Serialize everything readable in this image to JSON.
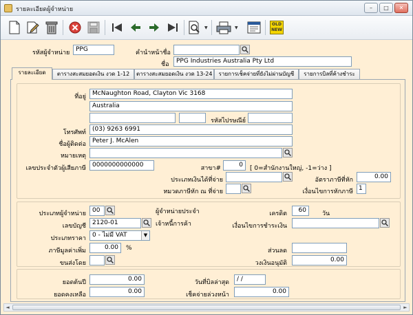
{
  "window": {
    "title": "รายละเอียดผู้จำหน่าย"
  },
  "titlebar": {
    "minimize": "–",
    "maximize": "□",
    "close": "✕"
  },
  "toolbar": {
    "new_icon_text": "OLD NEW"
  },
  "header": {
    "vendor_code_label": "รหัสผู้จำหน่าย",
    "vendor_code": "PPG",
    "prefix_label": "คำนำหน้าชื่อ",
    "prefix": "",
    "name_label": "ชื่อ",
    "name": "PPG Industries Australia Pty Ltd"
  },
  "tabs": [
    {
      "label": "รายละเอียด"
    },
    {
      "label": "ตารางสะสมยอดเงิน งวด  1-12"
    },
    {
      "label": "ตารางสะสมยอดเงิน งวด 13-24"
    },
    {
      "label": "รายการเช็คจ่ายที่ยังไม่ผ่านบัญชี"
    },
    {
      "label": "รายการบิลที่ค้างชำระ"
    }
  ],
  "details": {
    "address_label": "ที่อยู่",
    "address1": "McNaughton Road, Clayton Vic 3168",
    "address2": "Australia",
    "address3a": "",
    "address3b": "",
    "postcode_label": "รหัสไปรษณีย์",
    "postcode": "",
    "phone_label": "โทรศัพท์",
    "phone": "(03) 9263 6991",
    "contact_label": "ชื่อผู้ติดต่อ",
    "contact": "Peter J. McAlen",
    "note_label": "หมายเหตุ",
    "note": "",
    "taxid_label": "เลขประจำตัวผู้เสียภาษี",
    "taxid": "0000000000000",
    "branch_label": "สาขา#",
    "branch": "0",
    "branch_hint": "[ 0=สำนักงานใหญ่, -1=ว่าง ]",
    "payment_type_label": "ประเภทเงินได้ที่จ่าย",
    "payment_type": "",
    "wht_rate_label": "อัตราภาษีที่หัก",
    "wht_rate": "0.00",
    "wht_category_label": "หมวดภาษีหัก ณ ที่จ่าย",
    "wht_category": "",
    "wht_condition_label": "เงื่อนไขการหักภาษี",
    "wht_condition": "1"
  },
  "trade": {
    "vendor_type_label": "ประเภทผู้จำหน่าย",
    "vendor_type": "00",
    "regular_vendor_label": "ผู้จำหน่ายประจำ",
    "credit_label": "เครดิต",
    "credit_days": "60",
    "days_label": "วัน",
    "account_label": "เลขบัญชี",
    "account": "2120-01",
    "trade_creditor_label": "เจ้าหนี้การค้า",
    "payment_terms_label": "เงื่อนไขการชำระเงิน",
    "payment_terms": "",
    "price_type_label": "ประเภทราคา",
    "price_type": "0 - ไม่มี VAT",
    "vat_label": "ภาษีมูลค่าเพิ่ม",
    "vat": "0.00",
    "percent_label": "%",
    "discount_label": "ส่วนลด",
    "discount": "",
    "ship_by_label": "ขนส่งโดย",
    "ship_by": "",
    "credit_limit_label": "วงเงินอนุมัติ",
    "credit_limit": "0.00"
  },
  "balances": {
    "opening_label": "ยอดต้นปี",
    "opening": "0.00",
    "last_bill_label": "วันที่บิลล่าสุด",
    "last_bill": " /  /",
    "balance_label": "ยอดคงเหลือ",
    "balance": "0.00",
    "advance_cheque_label": "เช็คจ่ายล่วงหน้า",
    "advance_cheque": "0.00"
  },
  "colors": {
    "form_bg": "#ffefd5",
    "field_border": "#7f9db9",
    "exit_red": "#d9413a"
  }
}
